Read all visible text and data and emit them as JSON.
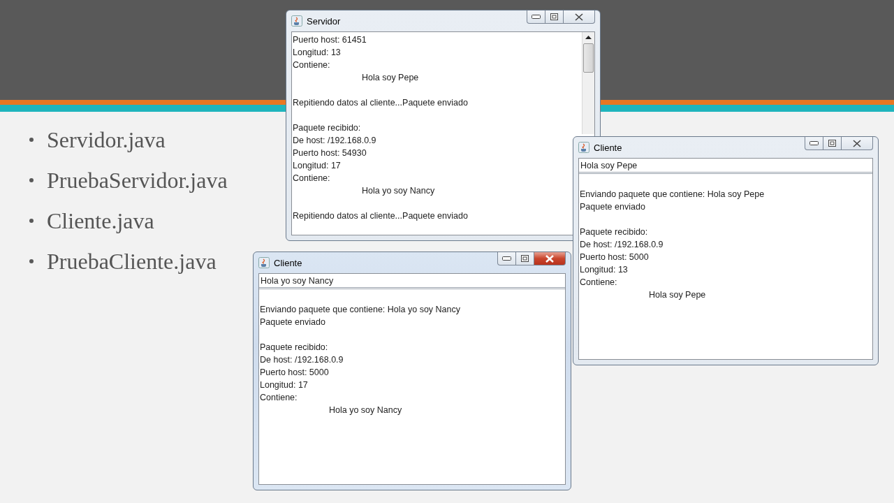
{
  "slide": {
    "bullets": [
      "Servidor.java",
      "PruebaServidor.java",
      "Cliente.java",
      "PruebaCliente.java"
    ]
  },
  "windows": [
    {
      "title": "Servidor",
      "active": false,
      "scrollbar": true,
      "blocks": [
        {
          "lines": [
            {
              "text": "Puerto host: 61451",
              "kind": "plain"
            },
            {
              "text": "Longitud: 13",
              "kind": "plain"
            },
            {
              "text": "Contiene:",
              "kind": "plain"
            },
            {
              "text": "Hola soy Pepe",
              "kind": "indented"
            }
          ]
        },
        {
          "lines": [
            {
              "text": "Repitiendo datos al cliente...Paquete enviado",
              "kind": "plain"
            }
          ]
        },
        {
          "lines": [
            {
              "text": "Paquete recibido:",
              "kind": "plain"
            },
            {
              "text": "De host: /192.168.0.9",
              "kind": "plain"
            },
            {
              "text": "Puerto host: 54930",
              "kind": "plain"
            },
            {
              "text": "Longitud: 17",
              "kind": "plain"
            },
            {
              "text": "Contiene:",
              "kind": "plain"
            },
            {
              "text": "Hola yo soy Nancy",
              "kind": "indented"
            }
          ]
        },
        {
          "lines": [
            {
              "text": "Repitiendo datos al cliente...Paquete enviado",
              "kind": "plain"
            }
          ]
        }
      ]
    },
    {
      "title": "Cliente",
      "active": false,
      "scrollbar": false,
      "input": "Hola soy Pepe",
      "blocks": [
        {
          "lines": [
            {
              "text": "Enviando paquete que contiene: Hola soy Pepe",
              "kind": "plain"
            },
            {
              "text": "Paquete enviado",
              "kind": "plain"
            }
          ]
        },
        {
          "lines": [
            {
              "text": "Paquete recibido:",
              "kind": "plain"
            },
            {
              "text": "De host: /192.168.0.9",
              "kind": "plain"
            },
            {
              "text": "Puerto host: 5000",
              "kind": "plain"
            },
            {
              "text": "Longitud: 13",
              "kind": "plain"
            },
            {
              "text": "Contiene:",
              "kind": "plain"
            },
            {
              "text": "Hola soy Pepe",
              "kind": "indented"
            }
          ]
        }
      ]
    },
    {
      "title": "Cliente",
      "active": true,
      "scrollbar": false,
      "input": "Hola yo soy Nancy",
      "blocks": [
        {
          "lines": [
            {
              "text": "Enviando paquete que contiene: Hola yo soy Nancy",
              "kind": "plain"
            },
            {
              "text": "Paquete enviado",
              "kind": "plain"
            }
          ]
        },
        {
          "lines": [
            {
              "text": "Paquete recibido:",
              "kind": "plain"
            },
            {
              "text": "De host: /192.168.0.9",
              "kind": "plain"
            },
            {
              "text": "Puerto host: 5000",
              "kind": "plain"
            },
            {
              "text": "Longitud: 17",
              "kind": "plain"
            },
            {
              "text": "Contiene:",
              "kind": "plain"
            },
            {
              "text": "Hola yo soy Nancy",
              "kind": "indented"
            }
          ]
        }
      ]
    }
  ]
}
